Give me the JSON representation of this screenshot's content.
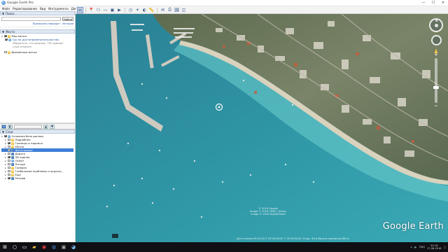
{
  "window": {
    "title": "Google Earth Pro",
    "minimize": "—",
    "maximize": "☐",
    "close": "✕"
  },
  "menu": [
    "Файл",
    "Редактирование",
    "Вид",
    "Инструменты",
    "Добавить",
    "Справка"
  ],
  "search": {
    "header": "Поиск",
    "placeholder": "",
    "button": "Найти",
    "link_route": "Проложить маршрут",
    "link_history": "История"
  },
  "places": {
    "header": "Места",
    "items": [
      {
        "label": "Мои метки",
        "style": "normal"
      },
      {
        "label": "Тур по достопримечательностям",
        "style": "link"
      },
      {
        "label": "Убедитесь, что флажок \"3D-здания\"",
        "style": "grey"
      },
      {
        "label": "слоя отмечен",
        "style": "grey"
      },
      {
        "label": "Временные метки",
        "style": "normal"
      }
    ]
  },
  "layers": {
    "header": "Слои",
    "items": [
      {
        "label": "Основная база данных",
        "checked": true,
        "icon": "globe-icon",
        "selected": false
      },
      {
        "label": "Подробнее",
        "checked": false,
        "icon": "folder-icon",
        "selected": false
      },
      {
        "label": "Границы и надписи",
        "checked": true,
        "icon": "folder-icon",
        "selected": false
      },
      {
        "label": "Метки",
        "checked": false,
        "icon": "folder-icon",
        "selected": false
      },
      {
        "label": "Фотографии",
        "checked": false,
        "icon": "layer-icon",
        "selected": true
      },
      {
        "label": "Дороги",
        "checked": false,
        "icon": "layer-icon",
        "selected": false
      },
      {
        "label": "3D-здания",
        "checked": true,
        "icon": "layer-icon",
        "selected": false
      },
      {
        "label": "Океан",
        "checked": false,
        "icon": "globe-icon",
        "selected": false
      },
      {
        "label": "Погода",
        "checked": false,
        "icon": "layer-icon",
        "selected": false
      },
      {
        "label": "Галерея",
        "checked": false,
        "icon": "folder-icon",
        "selected": false
      },
      {
        "label": "Глобальные проблемы и окружа...",
        "checked": false,
        "icon": "folder-icon",
        "selected": false
      },
      {
        "label": "Еще",
        "checked": false,
        "icon": "folder-icon",
        "selected": false
      },
      {
        "label": "Рельеф",
        "checked": true,
        "icon": "layer-icon",
        "selected": false
      }
    ]
  },
  "map": {
    "credit_line1": "© 2018 Google",
    "credit_line2": "Image © 2018 CNES / Airbus",
    "credit_line3": "Image © 2018 DigitalGlobe",
    "logo": "Google Earth",
    "imagery_date": "Дата съемки 09.04.2017   43°34'44.61\" С  39°42'50.81\" В   выс. 60 м   Высота просмотра 863 м",
    "compass_label": "N"
  },
  "taskbar": {
    "time": "20:18",
    "date": "17.08.2018",
    "lang": "ENG"
  },
  "colors": {
    "sea": "#2f8fa3",
    "shore": "#7fd3d3",
    "land": "#6c7a5e",
    "selection": "#3f7fd6"
  }
}
